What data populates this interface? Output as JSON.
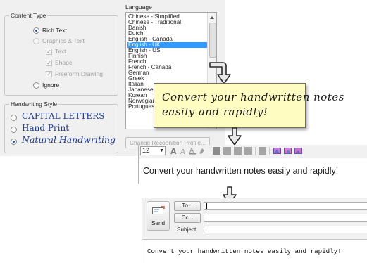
{
  "content_type": {
    "title": "Content Type",
    "options": [
      {
        "label": "Rich Text",
        "state": "selected"
      },
      {
        "label": "Graphics & Text",
        "state": "disabled"
      },
      {
        "label": "Ignore",
        "state": "unselected"
      }
    ],
    "sub_options": [
      "Text",
      "Shape",
      "Freeform Drawing"
    ]
  },
  "handwriting_style": {
    "title": "Handwriting Style",
    "options": [
      {
        "label": "CAPITAL LETTERS",
        "state": "unselected"
      },
      {
        "label": "Hand Print",
        "state": "unselected"
      },
      {
        "label": "Natural Handwriting",
        "state": "selected"
      }
    ]
  },
  "language": {
    "title": "Language",
    "items": [
      "Chinese - Simplified",
      "Chinese - Traditional",
      "Danish",
      "Dutch",
      "English - Canada",
      "English - UK",
      "English - US",
      "Finnish",
      "French",
      "French - Canada",
      "German",
      "Greek",
      "Italian",
      "Japanese",
      "Korean",
      "Norwegian",
      "Portuguese"
    ],
    "selected": "English - UK",
    "profile_button": "Change Recognition Profile..."
  },
  "note": {
    "line1": "Convert your handwritten notes",
    "line2": "easily and rapidly!"
  },
  "editor": {
    "font_size": "12",
    "text": "Convert your handwritten notes easily and rapidly!"
  },
  "email": {
    "send_label": "Send",
    "to_label": "To...",
    "cc_label": "Cc...",
    "subject_label": "Subject:",
    "body": "Convert your handwritten notes easily and rapidly!"
  },
  "colors": {
    "selection": "#3399ff",
    "note_bg": "#fffcc2",
    "radio_dot": "#1b56b7"
  }
}
